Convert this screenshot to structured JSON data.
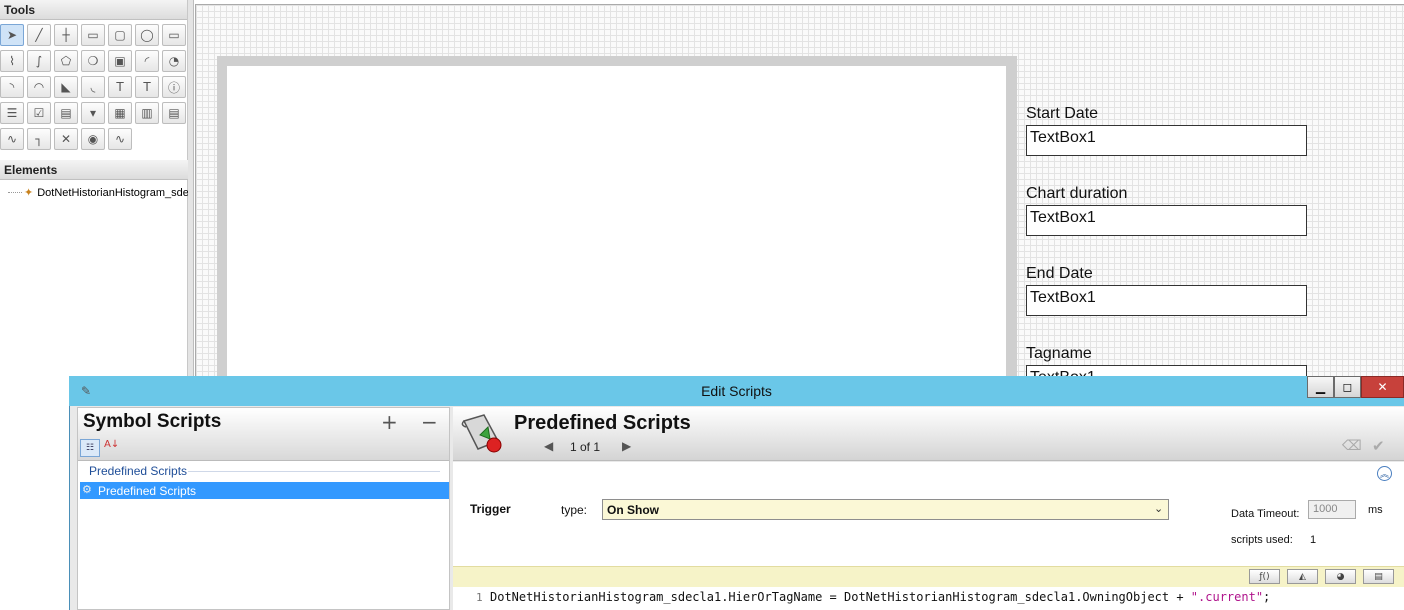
{
  "tools_panel": {
    "title": "Tools",
    "elements_title": "Elements",
    "tree_item": "DotNetHistorianHistogram_sde",
    "tools": [
      {
        "name": "pointer-tool-icon",
        "glyph": "➤"
      },
      {
        "name": "line-tool-icon",
        "glyph": "╱"
      },
      {
        "name": "hv-line-tool-icon",
        "glyph": "┼"
      },
      {
        "name": "rectangle-tool-icon",
        "glyph": "▭"
      },
      {
        "name": "rounded-rectangle-tool-icon",
        "glyph": "▢"
      },
      {
        "name": "ellipse-tool-icon",
        "glyph": "◯"
      },
      {
        "name": "button-tool-icon",
        "glyph": "▭"
      },
      {
        "name": "polyline-tool-icon",
        "glyph": "⌇"
      },
      {
        "name": "curve-tool-icon",
        "glyph": "∫"
      },
      {
        "name": "polygon-tool-icon",
        "glyph": "⬠"
      },
      {
        "name": "closed-curve-tool-icon",
        "glyph": "❍"
      },
      {
        "name": "image-tool-icon",
        "glyph": "▣"
      },
      {
        "name": "arc-tool-icon",
        "glyph": "◜"
      },
      {
        "name": "pie-tool-icon",
        "glyph": "◔"
      },
      {
        "name": "chord-tool-icon",
        "glyph": "◝"
      },
      {
        "name": "two-point-arc-tool-icon",
        "glyph": "◠"
      },
      {
        "name": "two-point-pie-tool-icon",
        "glyph": "◣"
      },
      {
        "name": "three-point-arc-tool-icon",
        "glyph": "◟"
      },
      {
        "name": "text-tool-icon",
        "glyph": "T"
      },
      {
        "name": "textbox-tool-icon",
        "glyph": "T"
      },
      {
        "name": "status-tool-icon",
        "glyph": "ⓘ"
      },
      {
        "name": "radio-group-tool-icon",
        "glyph": "☰"
      },
      {
        "name": "checkbox-tool-icon",
        "glyph": "☑"
      },
      {
        "name": "edit-box-tool-icon",
        "glyph": "▤"
      },
      {
        "name": "combo-box-tool-icon",
        "glyph": "▾"
      },
      {
        "name": "calendar-tool-icon",
        "glyph": "▦"
      },
      {
        "name": "datetime-tool-icon",
        "glyph": "▥"
      },
      {
        "name": "list-box-tool-icon",
        "glyph": "▤"
      },
      {
        "name": "pipe-tool-icon",
        "glyph": "∿"
      },
      {
        "name": "connector-tool-icon",
        "glyph": "┐"
      },
      {
        "name": "cross-tool-icon",
        "glyph": "✕"
      },
      {
        "name": "gauge-tool-icon",
        "glyph": "◉"
      },
      {
        "name": "trend-tool-icon",
        "glyph": "∿"
      }
    ]
  },
  "canvas": {
    "fields": [
      {
        "label": "Start Date",
        "value": "TextBox1"
      },
      {
        "label": "Chart duration",
        "value": "TextBox1"
      },
      {
        "label": "End Date",
        "value": "TextBox1"
      },
      {
        "label": "Tagname",
        "value": "TextBox1"
      }
    ]
  },
  "dialog": {
    "title": "Edit Scripts",
    "window_buttons": {
      "minimize": "▁",
      "maximize": "◻",
      "close": "✕"
    },
    "symbol_scripts": {
      "title": "Symbol Scripts",
      "add": "+",
      "remove": "−",
      "group_label": "Predefined Scripts",
      "selected_item": "Predefined Scripts"
    },
    "predefined": {
      "title": "Predefined Scripts",
      "pager": "1 of 1",
      "trigger_label": "Trigger",
      "type_label": "type:",
      "type_value": "On Show",
      "data_timeout_label": "Data Timeout:",
      "data_timeout_value": "1000",
      "ms_label": "ms",
      "scripts_used_label": "scripts used:",
      "scripts_used_value": "1",
      "code_line_number": "1",
      "code_prefix": "DotNetHistorianHistogram_sdecla1.HierOrTagName = DotNetHistorianHistogram_sdecla1.OwningObject + ",
      "code_string": "\".current\"",
      "code_suffix": ";"
    }
  }
}
